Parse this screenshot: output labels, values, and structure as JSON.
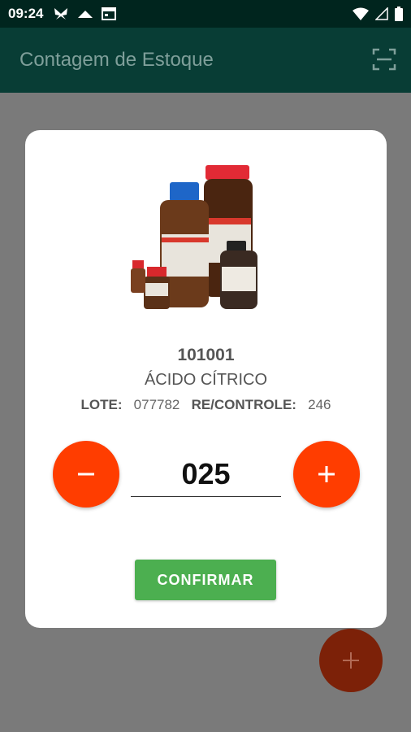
{
  "status_bar": {
    "time": "09:24",
    "left_icons": [
      "butterfly-icon",
      "cloud-icon",
      "calendar-icon"
    ],
    "right_icons": [
      "wifi-icon",
      "signal-icon",
      "battery-icon"
    ]
  },
  "app_bar": {
    "title": "Contagem de Estoque",
    "action_icon": "barcode-scan-icon"
  },
  "dialog": {
    "product_code": "101001",
    "product_name": "ÁCIDO CÍTRICO",
    "lot_label": "LOTE:",
    "lot_value": "077782",
    "control_label": "RE/CONTROLE:",
    "control_value": "246",
    "quantity": "025",
    "decrement_icon": "minus-icon",
    "increment_icon": "plus-icon",
    "confirm_label": "CONFIRMAR"
  },
  "fab": {
    "icon": "plus-icon"
  },
  "colors": {
    "status_bar": "#00251e",
    "app_bar": "#083d35",
    "accent": "#ff3d00",
    "confirm": "#4caf50",
    "scrim": "#7a7a7a"
  }
}
